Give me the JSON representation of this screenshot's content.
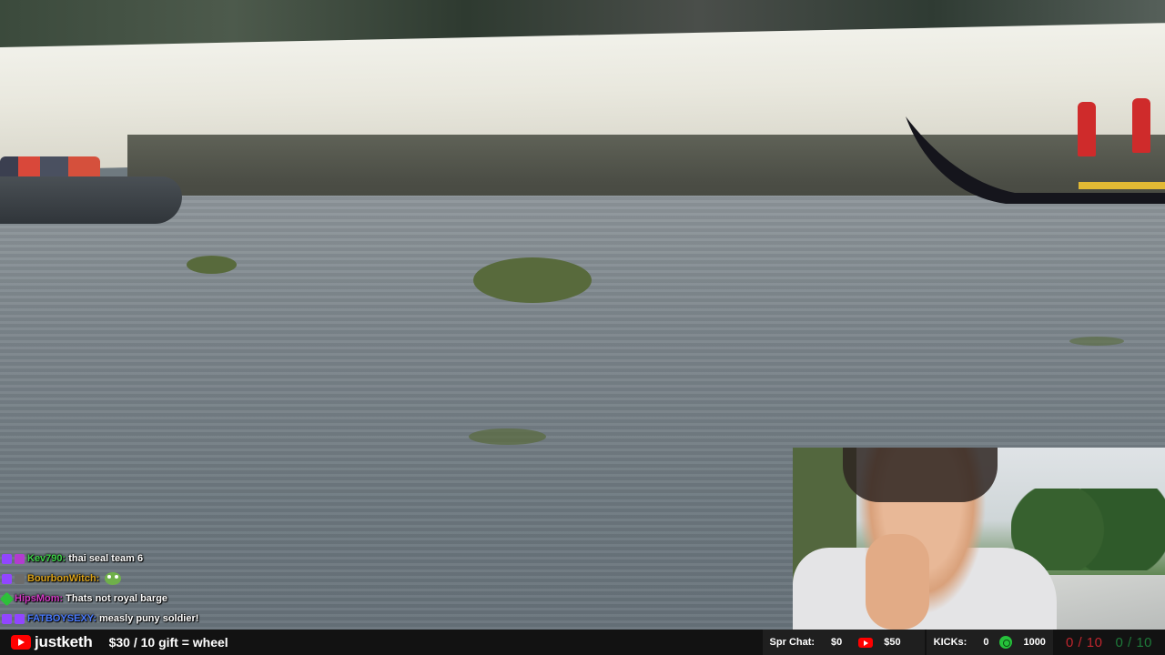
{
  "chat": {
    "messages": [
      {
        "user": "Kev790:",
        "text": "thai seal team 6",
        "user_color": "#3fd14a",
        "badge_colors": [
          "#9146ff",
          "#b23ccf"
        ],
        "emote": ""
      },
      {
        "user": "BourbonWitch:",
        "text": "",
        "user_color": "#d9a21b",
        "badge_colors": [
          "#9146ff",
          "#6c6c6c"
        ],
        "emote": "pepe-frog-emote"
      },
      {
        "user": "HipsMom:",
        "text": "Thats not royal barge",
        "user_color": "#d03bc3",
        "badge_colors": [
          "#2dbf3a"
        ],
        "emote": ""
      },
      {
        "user": "FATBOYSEXY:",
        "text": "measly puny soldier!",
        "user_color": "#4a7bff",
        "badge_colors": [
          "#9146ff",
          "#9146ff"
        ],
        "emote": ""
      }
    ]
  },
  "bottom_bar": {
    "channel_icon": "youtube-icon",
    "channel_name": "justketh",
    "promo": "$30 / 10 gift = wheel",
    "spr_chat_label": "Spr Chat:",
    "spr_chat_value": "$0",
    "yt_value": "$50",
    "kicks_label": "KICKs:",
    "kicks_value": "0",
    "kick_target": "1000",
    "counter_red": "0 / 10",
    "counter_green": "0 / 10"
  },
  "colors": {
    "counter_red": "#c0262e",
    "counter_green": "#1e7a3a",
    "youtube_red": "#ff0000",
    "kick_green": "#26c23b"
  }
}
